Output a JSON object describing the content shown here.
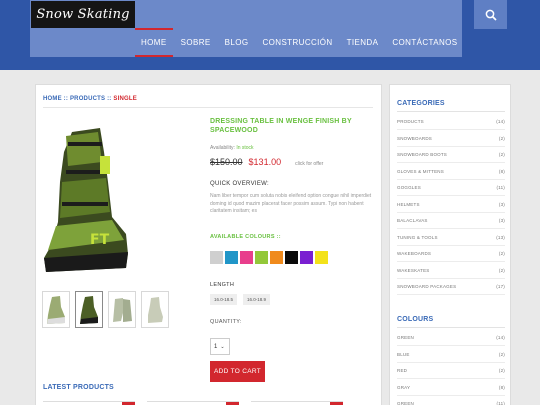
{
  "brand": {
    "logo": "Snow Skating"
  },
  "menu": [
    {
      "label": "HOME",
      "active": true
    },
    {
      "label": "SOBRE",
      "active": false
    },
    {
      "label": "BLOG",
      "active": false
    },
    {
      "label": "CONSTRUCCIÓN",
      "active": false
    },
    {
      "label": "TIENDA",
      "active": false
    },
    {
      "label": "CONTÁCTANOS",
      "active": false
    }
  ],
  "breadcrumb": {
    "home": "HOME",
    "sep1": " :: ",
    "products": "PRODUCTS",
    "sep2": " :: ",
    "current": "SINGLE"
  },
  "product": {
    "title": "DRESSING TABLE IN WENGE FINISH BY SPACEWOOD",
    "availability_label": "Availability: ",
    "availability_value": "In stock",
    "old_price": "$150.00",
    "new_price": "$131.00",
    "offer": "click for offer",
    "overview_title": "QUICK OVERVIEW:",
    "overview_text": "Nam liber tempor cum soluta nobis eleifend option congue nihil imperdiet doming id quod mazim placerat facer possim assum. Typi non habent claritatem insitam; es",
    "colours_title": "AVAILABLE COLOURS ::",
    "colours": [
      "#cfcfcf",
      "#2196c8",
      "#e83e8c",
      "#93c83a",
      "#f08a1c",
      "#0a0a0a",
      "#7a1fd1",
      "#f3e21a"
    ],
    "length_title": "LENGTH",
    "sizes": [
      "16.0-18.5",
      "16.0-18.9"
    ],
    "quantity_title": "QUANTITY:",
    "quantity_value": "1",
    "cart_label": "ADD TO CART"
  },
  "latest": {
    "title": "LATEST PRODUCTS"
  },
  "sidebar": {
    "categories_title": "CATEGORIES",
    "categories": [
      {
        "name": "PRODUCTS",
        "count": "(14)"
      },
      {
        "name": "SNOWBOARDS",
        "count": "(2)"
      },
      {
        "name": "SNOWBOARD BOOTS",
        "count": "(2)"
      },
      {
        "name": "GLOVES & MITTENS",
        "count": "(8)"
      },
      {
        "name": "GOGGLES",
        "count": "(11)"
      },
      {
        "name": "HELMETS",
        "count": "(3)"
      },
      {
        "name": "BALACLAVAS",
        "count": "(3)"
      },
      {
        "name": "TUNING & TOOLS",
        "count": "(13)"
      },
      {
        "name": "WAKEBOARDS",
        "count": "(2)"
      },
      {
        "name": "WAKESKATES",
        "count": "(2)"
      },
      {
        "name": "SNOWBOARD PACKAGES",
        "count": "(17)"
      }
    ],
    "colours_title": "COLOURS",
    "colours": [
      {
        "name": "GREEN",
        "count": "(14)"
      },
      {
        "name": "BLUE",
        "count": "(2)"
      },
      {
        "name": "RED",
        "count": "(2)"
      },
      {
        "name": "GRAY",
        "count": "(8)"
      },
      {
        "name": "GREEN",
        "count": "(11)"
      }
    ]
  }
}
